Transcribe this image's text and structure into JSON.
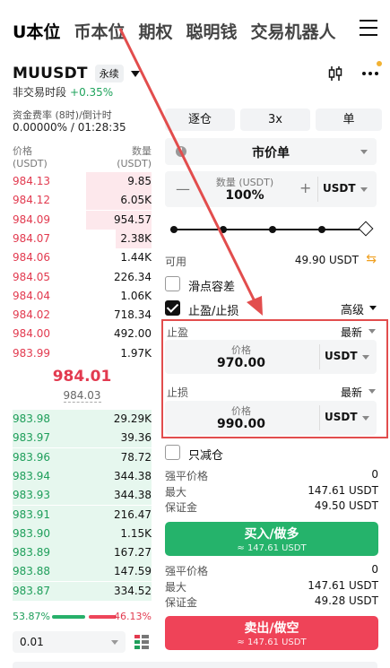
{
  "nav": {
    "tabs": [
      "U本位",
      "币本位",
      "期权",
      "聪明钱",
      "交易机器人"
    ]
  },
  "pair": {
    "symbol": "MUUSDT",
    "tag": "永续",
    "status": "非交易时段",
    "change": "+0.35%"
  },
  "funding": {
    "label": "资金费率 (8时)/倒计时",
    "value": "0.00000% / 01:28:35"
  },
  "orderbook": {
    "price_header": "价格",
    "price_unit": "(USDT)",
    "qty_header": "数量",
    "qty_unit": "(USDT)",
    "asks": [
      {
        "price": "984.13",
        "qty": "9.85",
        "depth": 0.47
      },
      {
        "price": "984.12",
        "qty": "6.05K",
        "depth": 0.47
      },
      {
        "price": "984.09",
        "qty": "954.57",
        "depth": 0.47
      },
      {
        "price": "984.07",
        "qty": "2.38K",
        "depth": 0.26
      },
      {
        "price": "984.06",
        "qty": "1.44K",
        "depth": 0.0
      },
      {
        "price": "984.05",
        "qty": "226.34",
        "depth": 0.0
      },
      {
        "price": "984.04",
        "qty": "1.06K",
        "depth": 0.0
      },
      {
        "price": "984.02",
        "qty": "718.34",
        "depth": 0.0
      },
      {
        "price": "984.00",
        "qty": "492.00",
        "depth": 0.0
      },
      {
        "price": "983.99",
        "qty": "1.97K",
        "depth": 0.0
      }
    ],
    "last_price": "984.01",
    "mark_price": "984.03",
    "bids": [
      {
        "price": "983.98",
        "qty": "29.29K",
        "depth": 1.0
      },
      {
        "price": "983.97",
        "qty": "39.36",
        "depth": 1.0
      },
      {
        "price": "983.96",
        "qty": "78.72",
        "depth": 1.0
      },
      {
        "price": "983.94",
        "qty": "344.38",
        "depth": 1.0
      },
      {
        "price": "983.93",
        "qty": "344.38",
        "depth": 1.0
      },
      {
        "price": "983.91",
        "qty": "216.47",
        "depth": 1.0
      },
      {
        "price": "983.90",
        "qty": "1.15K",
        "depth": 1.0
      },
      {
        "price": "983.89",
        "qty": "167.27",
        "depth": 1.0
      },
      {
        "price": "983.88",
        "qty": "147.59",
        "depth": 1.0
      },
      {
        "price": "983.87",
        "qty": "334.52",
        "depth": 1.0
      }
    ],
    "buy_ratio": "53.87%",
    "sell_ratio": "46.13%",
    "buy_fraction": 0.5387,
    "precision": "0.01"
  },
  "order": {
    "margin_mode": "逐仓",
    "leverage": "3x",
    "position_mode": "单",
    "order_type": "市价单",
    "qty_label": "数量 (USDT)",
    "qty_value": "100%",
    "qty_unit": "USDT",
    "slider_fraction": 1.0,
    "available_label": "可用",
    "available_value": "49.90 USDT",
    "slippage_label": "滑点容差",
    "tpsl_label": "止盈/止损",
    "advanced_label": "高级",
    "tp": {
      "title": "止盈",
      "trigger": "最新",
      "price_label": "价格",
      "price": "970.00",
      "unit": "USDT"
    },
    "sl": {
      "title": "止损",
      "trigger": "最新",
      "price_label": "价格",
      "price": "990.00",
      "unit": "USDT"
    },
    "reduce_only_label": "只减仓",
    "long": {
      "liq_label": "强平价格",
      "liq_value": "0",
      "max_label": "最大",
      "max_value": "147.61 USDT",
      "margin_label": "保证金",
      "margin_value": "49.50 USDT",
      "button": "买入/做多",
      "button_sub": "≈ 147.61 USDT"
    },
    "short": {
      "liq_label": "强平价格",
      "liq_value": "0",
      "max_label": "最大",
      "max_value": "147.61 USDT",
      "margin_label": "保证金",
      "margin_value": "49.28 USDT",
      "button": "卖出/做空",
      "button_sub": "≈ 147.61 USDT"
    }
  },
  "colors": {
    "buy": "#25b36b",
    "sell": "#ef4358",
    "highlight": "#e24d4d",
    "accent": "#f0a020"
  }
}
